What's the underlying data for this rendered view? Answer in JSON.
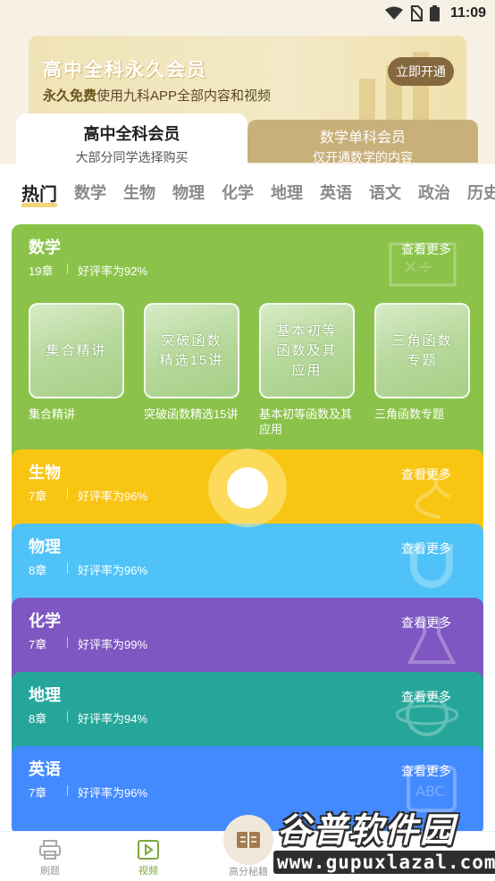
{
  "status_bar": {
    "time": "11:09"
  },
  "banner": {
    "title": "高中全科永久会员",
    "subtitle_bold": "永久免费",
    "subtitle_rest": "使用九科APP全部内容和视频",
    "button": "立即开通"
  },
  "member_tabs": [
    {
      "title": "高中全科会员",
      "desc": "大部分同学选择购买"
    },
    {
      "title": "数学单科会员",
      "desc": "仅开通数学的内容"
    }
  ],
  "subject_nav": [
    "热门",
    "数学",
    "生物",
    "物理",
    "化学",
    "地理",
    "英语",
    "语文",
    "政治",
    "历史"
  ],
  "cards": [
    {
      "name": "数学",
      "chapters": "19章",
      "rating": "好评率为92%",
      "more": "查看更多",
      "color": "#8bc34a",
      "icon": "math-board-icon",
      "courses": [
        {
          "thumb": "集合精讲",
          "caption": "集合精讲"
        },
        {
          "thumb": "突破函数精选15讲",
          "caption": "突破函数精选15讲"
        },
        {
          "thumb": "基本初等函数及其应用",
          "caption": "基本初等函数及其应用"
        },
        {
          "thumb": "三角函数专题",
          "caption": "三角函数专题"
        }
      ]
    },
    {
      "name": "生物",
      "chapters": "7章",
      "rating": "好评率为96%",
      "more": "查看更多",
      "color": "#f9c513",
      "icon": "dna-icon"
    },
    {
      "name": "物理",
      "chapters": "8章",
      "rating": "好评率为96%",
      "more": "查看更多",
      "color": "#4fc3f7",
      "icon": "magnet-icon"
    },
    {
      "name": "化学",
      "chapters": "7章",
      "rating": "好评率为99%",
      "more": "查看更多",
      "color": "#7e57c2",
      "icon": "flask-icon"
    },
    {
      "name": "地理",
      "chapters": "8章",
      "rating": "好评率为94%",
      "more": "查看更多",
      "color": "#26a69a",
      "icon": "globe-icon"
    },
    {
      "name": "英语",
      "chapters": "7章",
      "rating": "好评率为96%",
      "more": "查看更多",
      "color": "#448aff",
      "icon": "abc-icon"
    }
  ],
  "bottom_nav": {
    "items": [
      "刷题",
      "视频",
      "高分秘籍"
    ]
  },
  "watermark": {
    "cn": "谷普软件园",
    "url": "www.gupuxlazal.com"
  }
}
